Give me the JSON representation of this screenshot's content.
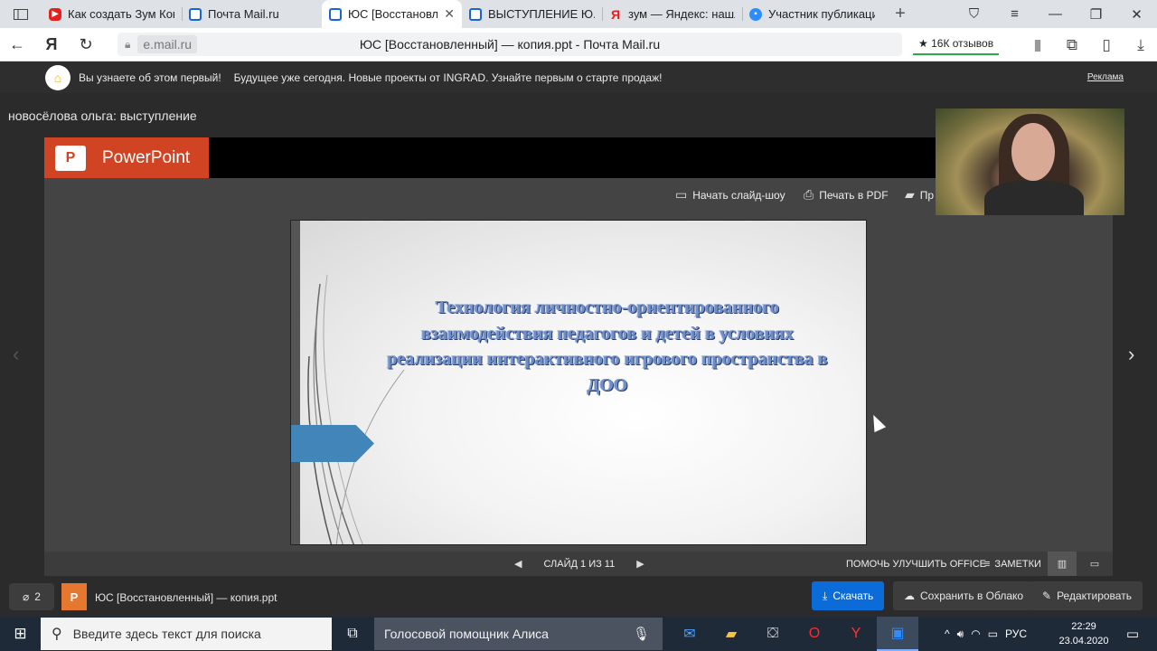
{
  "browser": {
    "tabs": [
      {
        "label": "Как создать Зум Конференцию",
        "favicon": "youtube-icon",
        "active": false
      },
      {
        "label": "Почта Mail.ru",
        "favicon": "mail-icon",
        "active": false
      },
      {
        "label": "ЮС [Восстановленный]",
        "favicon": "mail-icon",
        "active": true
      },
      {
        "label": "ВЫСТУПЛЕНИЕ Ю.С.",
        "favicon": "mail-icon",
        "active": false
      },
      {
        "label": "зум — Яндекс: нашлось",
        "favicon": "yandex-icon",
        "active": false
      },
      {
        "label": "Участник публикации",
        "favicon": "zoom-icon",
        "active": false
      }
    ],
    "domain": "e.mail.ru",
    "page_title": "ЮС [Восстановленный] — копия.ppt - Почта Mail.ru",
    "reviews": "★ 16К отзывов"
  },
  "ad": {
    "text1": "Вы узнаете об этом первый!",
    "text2": "Будущее уже сегодня. Новые проекты от INGRAD. Узнайте первым о старте продаж!",
    "mark": "Реклама"
  },
  "viewer": {
    "presenter": "новосёлова ольга: выступление",
    "brand": "PowerPoint",
    "tools": {
      "slideshow": "Начать слайд-шоу",
      "print": "Печать в PDF",
      "comments": "Пр"
    },
    "slide_title": "Технология личностно-ориентированного взаимодействия педагогов и детей в условиях реализации интерактивного игрового пространства в ДОО",
    "slide_counter": "СЛАЙД 1 ИЗ 11",
    "help": "ПОМОЧЬ УЛУЧШИТЬ OFFICE",
    "notes": "ЗАМЕТКИ"
  },
  "attachment": {
    "count": "2",
    "filename": "ЮС [Восстановленный] — копия.ppt",
    "download": "Скачать",
    "save_cloud": "Сохранить в Облако",
    "edit": "Редактировать"
  },
  "taskbar": {
    "search_placeholder": "Введите здесь текст для поиска",
    "alice": "Голосовой помощник Алиса",
    "lang": "РУС",
    "time": "22:29",
    "date": "23.04.2020"
  },
  "colors": {
    "powerpoint_brand": "#d04423",
    "download_button": "#0a6bd9",
    "slide_title": "#6f8fc8",
    "slide_arrow": "#4286b9"
  }
}
